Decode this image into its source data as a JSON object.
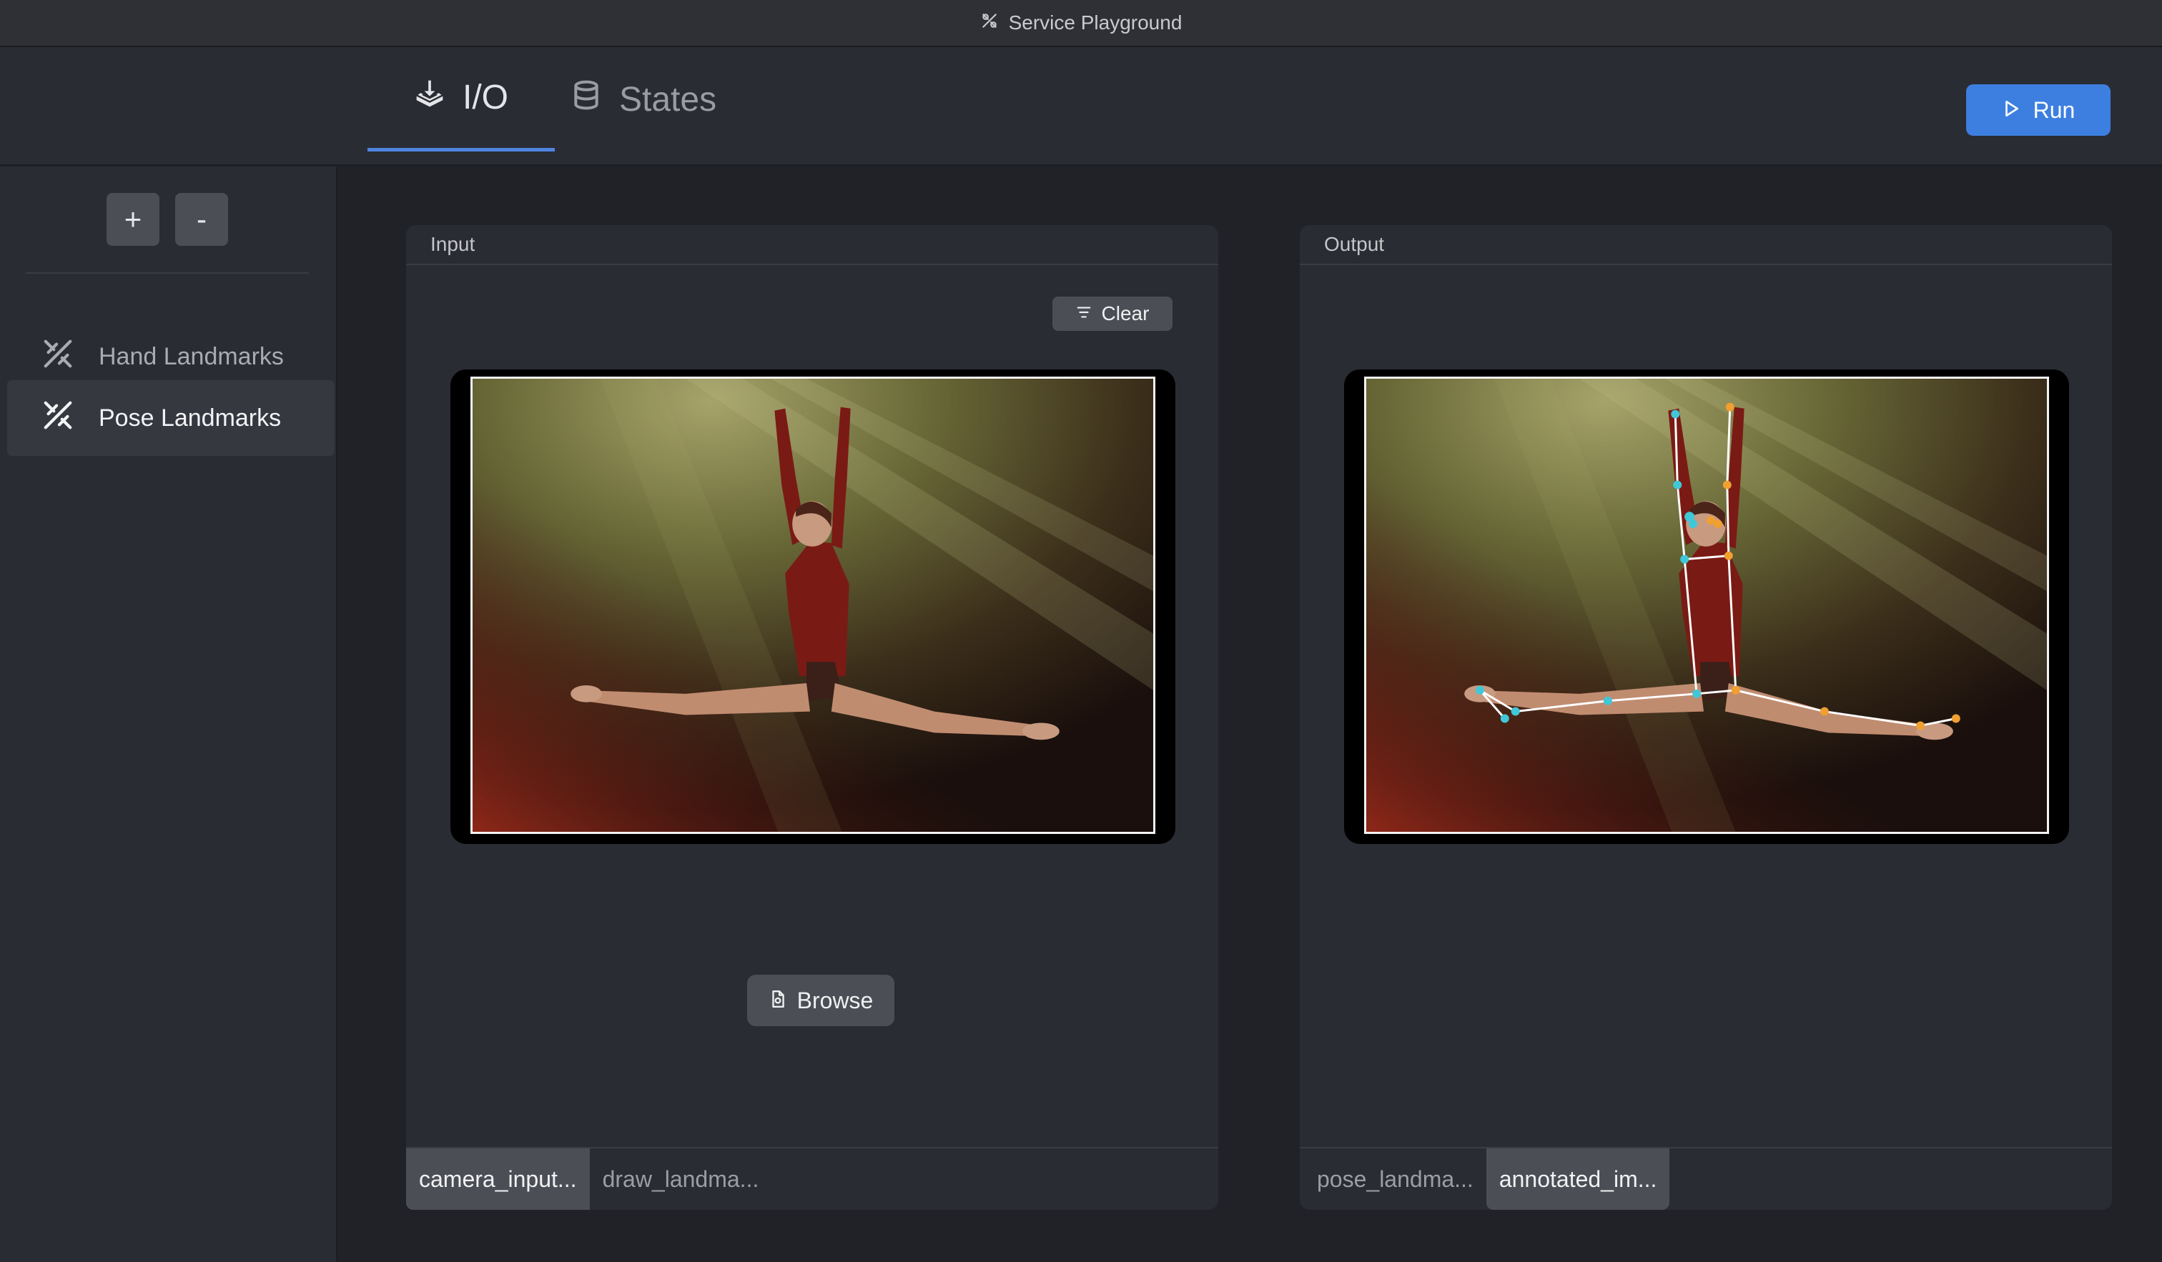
{
  "window": {
    "title": "Service Playground",
    "icon": "pose-landmarks-icon"
  },
  "tabs": [
    {
      "label": "I/O",
      "icon": "io-download-icon",
      "active": true
    },
    {
      "label": "States",
      "icon": "database-icon",
      "active": false
    }
  ],
  "run_button": {
    "label": "Run",
    "icon": "play-icon"
  },
  "sidebar": {
    "add_label": "+",
    "remove_label": "-",
    "items": [
      {
        "label": "Hand Landmarks",
        "icon": "landmarks-icon",
        "active": false
      },
      {
        "label": "Pose Landmarks",
        "icon": "landmarks-icon",
        "active": true
      }
    ]
  },
  "input_panel": {
    "title": "Input",
    "clear_label": "Clear",
    "browse_label": "Browse",
    "image_description_icon": "dancer-photo",
    "ports": [
      {
        "label": "camera_input...",
        "active": true
      },
      {
        "label": "draw_landma...",
        "active": false
      }
    ]
  },
  "output_panel": {
    "title": "Output",
    "image_description_icon": "annotated-dancer-photo",
    "ports": [
      {
        "label": "pose_landma...",
        "active": false
      },
      {
        "label": "annotated_im...",
        "active": true
      }
    ]
  },
  "colors": {
    "accent": "#3d7fe0",
    "tab_underline": "#4f83e0",
    "landmark_left": "#f0a030",
    "landmark_right": "#40c8d8"
  }
}
